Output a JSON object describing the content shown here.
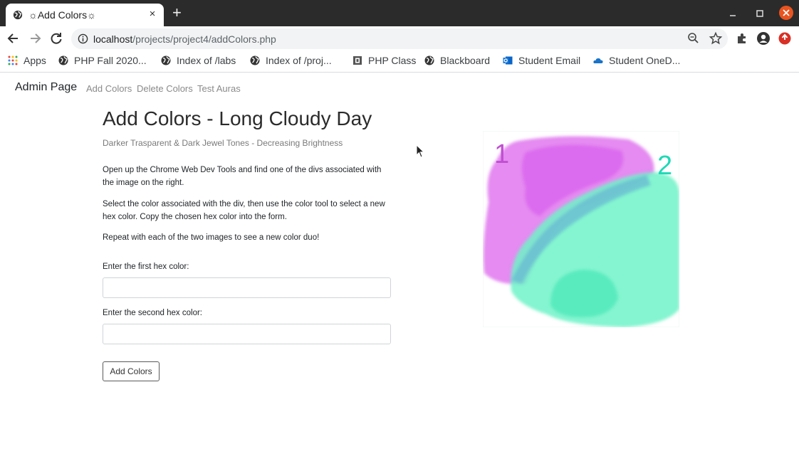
{
  "browser": {
    "tab_title": "☼Add Colors☼",
    "tab_close": "×",
    "new_tab": "+",
    "url_host": "localhost",
    "url_path": "/projects/project4/addColors.php"
  },
  "bookmarks": [
    {
      "label": "Apps",
      "icon": "apps-grid-icon"
    },
    {
      "label": "PHP Fall 2020...",
      "icon": "globe-icon"
    },
    {
      "label": "Index of /labs",
      "icon": "globe-icon"
    },
    {
      "label": "Index of /proj...",
      "icon": "globe-icon"
    },
    {
      "label": "PHP Class",
      "icon": "page-icon"
    },
    {
      "label": "Blackboard",
      "icon": "globe-icon"
    },
    {
      "label": "Student Email",
      "icon": "outlook-icon"
    },
    {
      "label": "Student OneD...",
      "icon": "onedrive-icon"
    }
  ],
  "navbar": {
    "brand": "Admin Page",
    "links": [
      "Add Colors",
      "Delete Colors",
      "Test Auras"
    ]
  },
  "main": {
    "title": "Add Colors - Long Cloudy Day",
    "subtitle": "Darker Trasparent & Dark Jewel Tones - Decreasing Brightness",
    "paragraphs": [
      "Open up the Chrome Web Dev Tools and find one of the divs associated with the image on the right.",
      "Select the color associated with the div, then use the color tool to select a new hex color. Copy the chosen hex color into the form.",
      "Repeat with each of the two images to see a new color duo!"
    ],
    "form": {
      "first_label": "Enter the first hex color:",
      "first_value": "",
      "second_label": "Enter the second hex color:",
      "second_value": "",
      "submit_label": "Add Colors"
    }
  },
  "artwork": {
    "label_1": "1",
    "label_2": "2",
    "color_1": "#e27ef0",
    "color_2": "#6ff3c8"
  },
  "colors": {
    "titlebar": "#2b2b2b",
    "omnibox": "#f1f3f4",
    "window_close": "#e95420",
    "extension_badge": "#d93025"
  }
}
